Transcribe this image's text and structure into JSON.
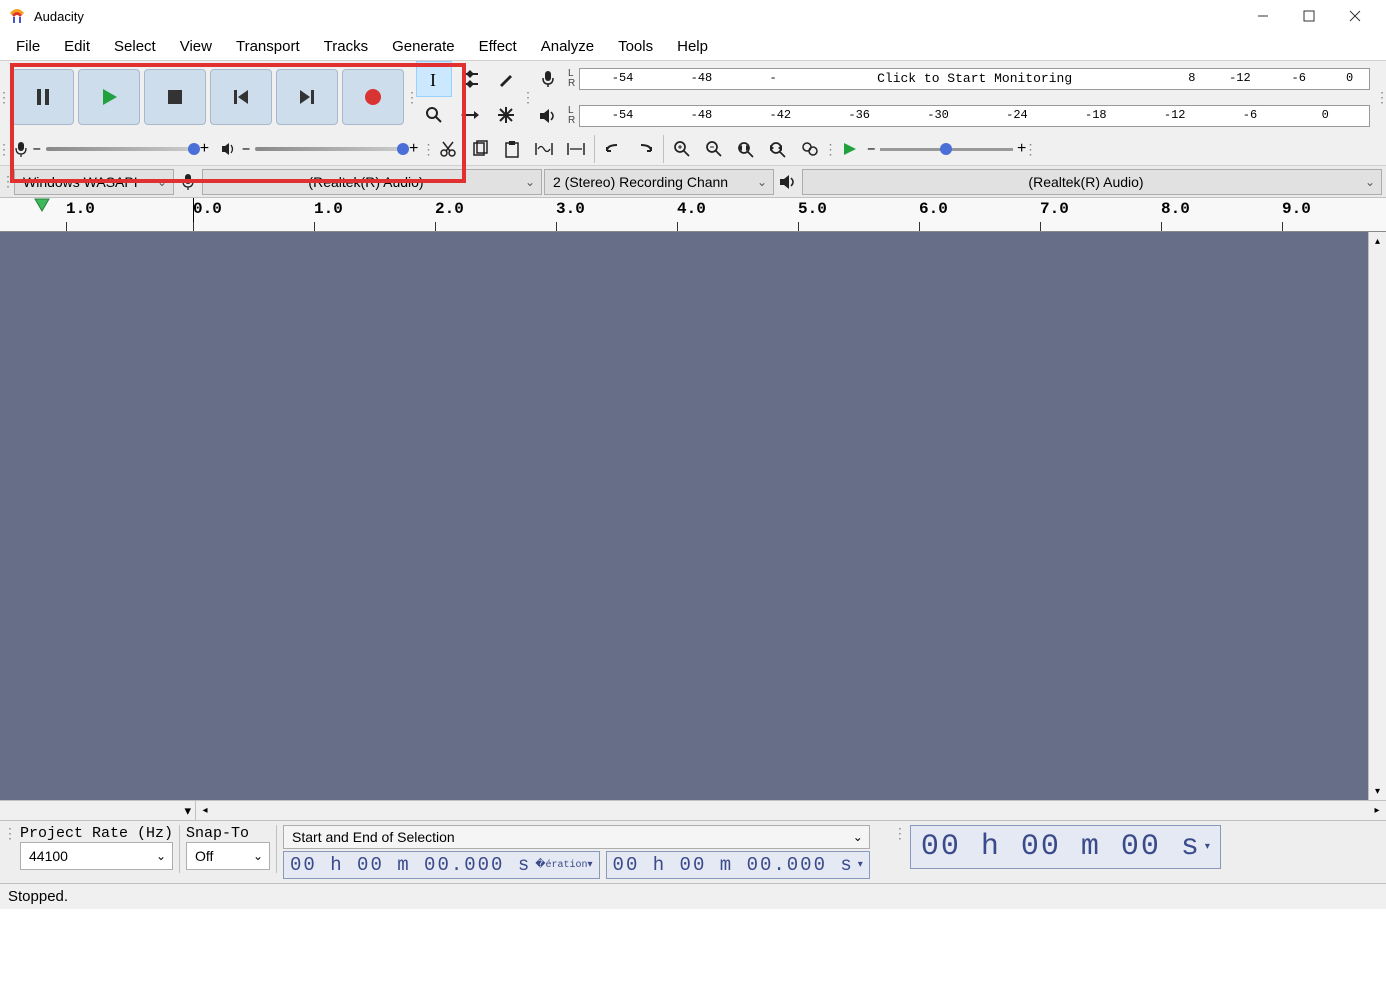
{
  "title": "Audacity",
  "menu": [
    "File",
    "Edit",
    "Select",
    "View",
    "Transport",
    "Tracks",
    "Generate",
    "Effect",
    "Analyze",
    "Tools",
    "Help"
  ],
  "meters": {
    "recording": {
      "ticks": [
        "-54",
        "-48",
        "-",
        "8",
        "-12",
        "-6",
        "0"
      ],
      "hint": "Click to Start Monitoring"
    },
    "playback": {
      "ticks": [
        "-54",
        "-48",
        "-42",
        "-36",
        "-30",
        "-24",
        "-18",
        "-12",
        "-6",
        "0"
      ]
    }
  },
  "sliders": {
    "rec_vol_minus": "–",
    "rec_vol_plus": "+",
    "play_vol_minus": "–",
    "play_vol_plus": "+",
    "speed_minus": "–",
    "speed_plus": "+"
  },
  "devices": {
    "host": "Windows WASAPI",
    "rec_device": "(Realtek(R) Audio)",
    "rec_channels": "2 (Stereo) Recording Chann",
    "play_device": "(Realtek(R) Audio)"
  },
  "ruler": [
    "1.0",
    "0.0",
    "1.0",
    "2.0",
    "3.0",
    "4.0",
    "5.0",
    "6.0",
    "7.0",
    "8.0",
    "9.0"
  ],
  "bottom": {
    "project_rate_label": "Project Rate (Hz)",
    "project_rate": "44100",
    "snap_label": "Snap-To",
    "snap": "Off",
    "selection_mode": "Start and End of Selection",
    "time1": "00 h 00 m 00.000 s",
    "time2": "00 h 00 m 00.000 s",
    "big_time": "00 h 00 m 00 s"
  },
  "status": "Stopped."
}
